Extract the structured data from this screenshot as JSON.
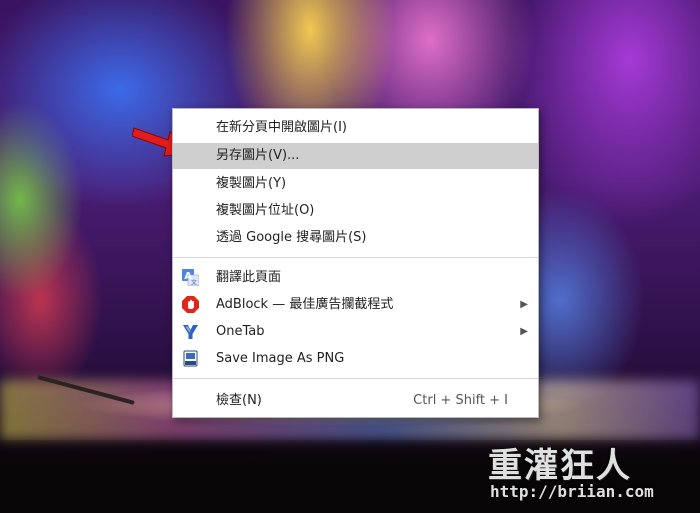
{
  "context_menu": {
    "items": [
      {
        "label": "在新分頁中開啟圖片(I)"
      },
      {
        "label": "另存圖片(V)..."
      },
      {
        "label": "複製圖片(Y)"
      },
      {
        "label": "複製圖片位址(O)"
      },
      {
        "label": "透過 Google 搜尋圖片(S)"
      }
    ],
    "extensions": [
      {
        "label": "翻譯此頁面",
        "icon": "google-translate-icon"
      },
      {
        "label": "AdBlock — 最佳廣告攔截程式",
        "icon": "adblock-icon",
        "submenu_glyph": "▶"
      },
      {
        "label": "OneTab",
        "icon": "onetab-icon",
        "submenu_glyph": "▶"
      },
      {
        "label": "Save Image As PNG",
        "icon": "save-png-icon"
      }
    ],
    "inspect": {
      "label": "檢查(N)",
      "shortcut": "Ctrl + Shift + I"
    },
    "highlight_color": "#cfcfcf"
  },
  "watermark": {
    "title": "重灌狂人",
    "url": "http://briian.com"
  },
  "colors": {
    "arrow": "#e21c1c"
  }
}
